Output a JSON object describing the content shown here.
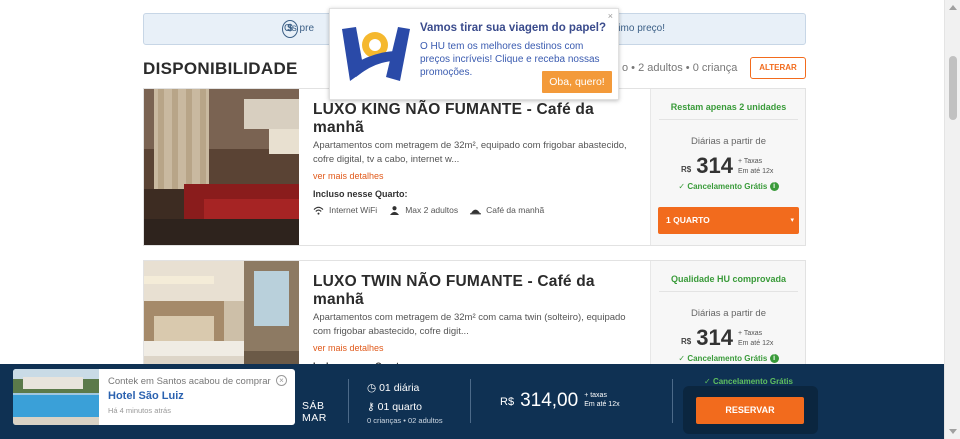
{
  "banner": {
    "left_text": "Os pre",
    "right_text": "timo preço!"
  },
  "section": {
    "title": "DISPONIBILIDADE",
    "guests": "o • 2 adultos • 0 criança",
    "alterar": "ALTERAR"
  },
  "rooms": [
    {
      "title": "LUXO KING NÃO FUMANTE - Café da manhã",
      "desc": "Apartamentos com metragem de 32m², equipado com frigobar abastecido, cofre digital, tv a cabo, internet w...",
      "more": "ver mais detalhes",
      "incluso": "Incluso nesse Quarto:",
      "amenities": [
        "Internet WiFi",
        "Max 2 adultos",
        "Café da manhã"
      ],
      "badge": "Restam apenas 2 unidades",
      "daily_label": "Diárias a partir de",
      "currency": "R$",
      "price": "314",
      "taxes": "+ Taxas",
      "installments": "Em até 12x",
      "cancel": "Cancelamento Grátis",
      "select": "1 QUARTO"
    },
    {
      "title": "LUXO TWIN NÃO FUMANTE - Café da manhã",
      "desc": "Apartamentos com metragem de 32m² com cama twin (solteiro), equipado com frigobar abastecido, cofre digit...",
      "more": "ver mais detalhes",
      "incluso": "Incluso nesse Quarto:",
      "badge": "Qualidade HU comprovada",
      "daily_label": "Diárias a partir de",
      "currency": "R$",
      "price": "314",
      "taxes": "+ Taxas",
      "installments": "Em até 12x",
      "cancel": "Cancelamento Grátis"
    }
  ],
  "popup": {
    "title": "Vamos tirar sua viagem do papel?",
    "text": "O HU tem os melhores destinos com preços incríveis! Clique e receba nossas promoções.",
    "button": "Oba, quero!",
    "close": "×"
  },
  "bar": {
    "notify_line": "Contek em Santos acabou de comprar",
    "notify_hotel": "Hotel São Luiz",
    "notify_time": "Há 4 minutos atrás",
    "day": "SÁB",
    "month": "MAR",
    "nights": "01 diária",
    "rooms": "01 quarto",
    "guests": "0 crianças • 02 adultos",
    "currency": "R$",
    "amount": "314,00",
    "taxes": "+ taxas",
    "installments": "Em até 12x",
    "cancel": "Cancelamento Grátis",
    "reserve": "RESERVAR"
  },
  "colors": {
    "accent": "#f26b1d",
    "navy": "#0f3153",
    "green": "#3a9b3a"
  }
}
